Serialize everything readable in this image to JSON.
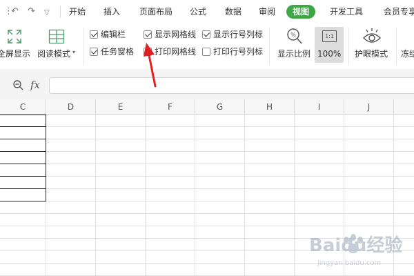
{
  "menubar": {
    "quick_access": [
      "undo-icon",
      "redo-icon",
      "dropdown-icon"
    ],
    "items": [
      {
        "label": "开始",
        "active": false
      },
      {
        "label": "插入",
        "active": false
      },
      {
        "label": "页面布局",
        "active": false
      },
      {
        "label": "公式",
        "active": false
      },
      {
        "label": "数据",
        "active": false
      },
      {
        "label": "审阅",
        "active": false
      },
      {
        "label": "视图",
        "active": true
      },
      {
        "label": "开发工具",
        "active": false
      },
      {
        "label": "会员专享",
        "active": false
      }
    ],
    "active_color": "#3ea645"
  },
  "ribbon": {
    "fullscreen_label": "全屏显示",
    "reading_mode_label": "阅读模式",
    "checkboxes": [
      {
        "label": "编辑栏",
        "checked": true
      },
      {
        "label": "任务窗格",
        "checked": true
      },
      {
        "label": "显示网格线",
        "checked": true
      },
      {
        "label": "打印网格线",
        "checked": false
      },
      {
        "label": "显示行号列标",
        "checked": true
      },
      {
        "label": "打印行号列标",
        "checked": false
      }
    ],
    "zoom_ratio_label": "显示比例",
    "zoom_100_label": "100%",
    "zoom_100_icon_text": "1:1",
    "eye_mode_label": "护眼模式",
    "freeze_label": "冻结"
  },
  "formula_bar": {
    "fx_label": "fx",
    "value": ""
  },
  "sheet": {
    "columns": [
      "C",
      "D",
      "E",
      "F",
      "G",
      "H",
      "I",
      "J"
    ],
    "annotation_color": "#e02020"
  },
  "watermark": {
    "text": "Baidu经验",
    "subtext": "jingyan.baidu.com"
  }
}
